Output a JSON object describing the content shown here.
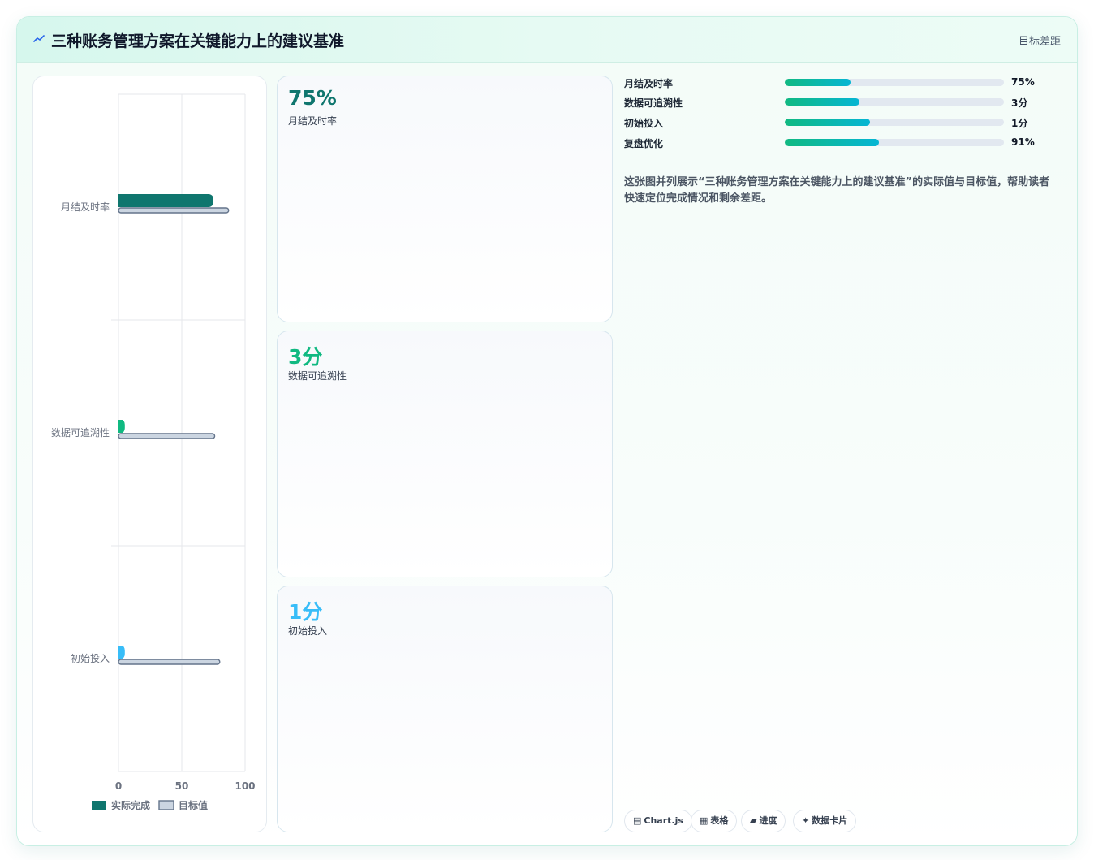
{
  "header": {
    "title": "三种账务管理方案在关键能力上的建议基准",
    "badge": "目标差距",
    "icon": "trend-line-icon"
  },
  "colors": {
    "accent_dark": "#0f766e",
    "accent_green": "#10b981",
    "accent_blue": "#38bdf8",
    "target": "#cbd5e1",
    "target_border": "#64748b"
  },
  "chart_data": {
    "type": "bar",
    "orientation": "horizontal",
    "categories": [
      "月结及时率",
      "数据可追溯性",
      "初始投入"
    ],
    "series": [
      {
        "name": "实际完成",
        "values": [
          75,
          5,
          5
        ],
        "colors": [
          "#0f766e",
          "#10b981",
          "#38bdf8"
        ]
      },
      {
        "name": "目标值",
        "values": [
          87,
          76,
          80
        ],
        "color": "#cbd5e1"
      }
    ],
    "xlim": [
      0,
      100
    ],
    "xticks": [
      "0",
      "50",
      "100"
    ],
    "grid": true,
    "legend": "bottom"
  },
  "stat_cards": [
    {
      "value": "75%",
      "label": "月结及时率",
      "color": "#0f766e"
    },
    {
      "value": "3分",
      "label": "数据可追溯性",
      "color": "#10b981"
    },
    {
      "value": "1分",
      "label": "初始投入",
      "color": "#38bdf8"
    }
  ],
  "progress": [
    {
      "label": "月结及时率",
      "value": "75%",
      "fraction": 0.3
    },
    {
      "label": "数据可追溯性",
      "value": "3分",
      "fraction": 0.34
    },
    {
      "label": "初始投入",
      "value": "1分",
      "fraction": 0.39
    },
    {
      "label": "复盘优化",
      "value": "91%",
      "fraction": 0.43
    }
  ],
  "description": "这张图并列展示“三种账务管理方案在关键能力上的建议基准”的实际值与目标值，帮助读者快速定位完成情况和剩余差距。",
  "tags": [
    {
      "icon": "chart-icon",
      "glyph": "▤",
      "label": "Chart.js"
    },
    {
      "icon": "table-icon",
      "glyph": "▦",
      "label": "表格"
    },
    {
      "icon": "progress-icon",
      "glyph": "▰",
      "label": "进度"
    },
    {
      "icon": "card-icon",
      "glyph": "✦",
      "label": "数据卡片"
    }
  ]
}
